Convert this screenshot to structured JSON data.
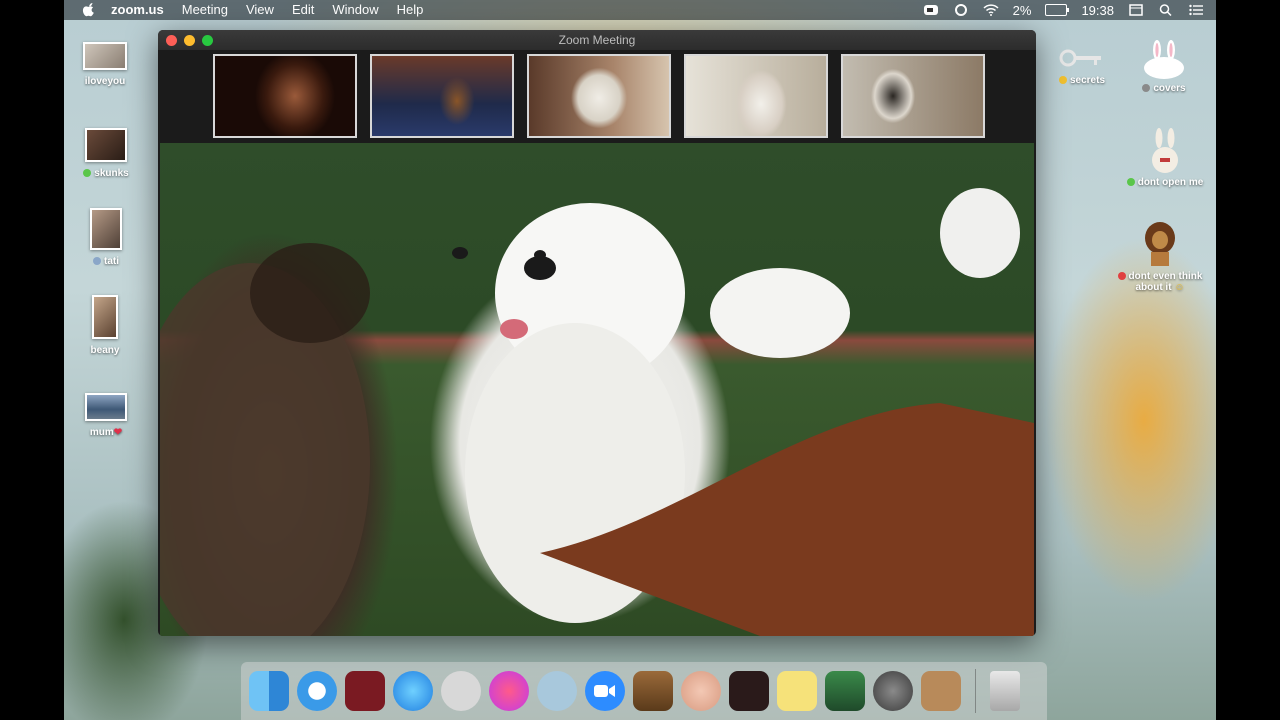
{
  "menubar": {
    "app_name": "zoom.us",
    "menus": [
      "Meeting",
      "View",
      "Edit",
      "Window",
      "Help"
    ],
    "battery_percent": "2%",
    "time": "19:38"
  },
  "desktop": {
    "left_items": [
      {
        "label": "iloveyou"
      },
      {
        "label": "skunks"
      },
      {
        "label": "tati"
      },
      {
        "label": "beany"
      },
      {
        "label": "mum"
      }
    ],
    "right_items": [
      {
        "label": "secrets"
      },
      {
        "label": "covers"
      },
      {
        "label": "dont open me"
      },
      {
        "label": "dont even think about it"
      }
    ]
  },
  "zoom": {
    "window_title": "Zoom Meeting",
    "participant_count": 5
  },
  "dock": {
    "apps": [
      "Finder",
      "Safari",
      "Photo Booth",
      "Messages",
      "Wallpaper",
      "iTunes",
      "Sequel",
      "Zoom",
      "GarageBand",
      "Face",
      "Photo Editor",
      "Stickies",
      "Preview",
      "System Preferences",
      "Contacts",
      "Trash"
    ]
  },
  "colors": {
    "close": "#fe5f57",
    "minimize": "#febc2e",
    "zoom": "#28c840",
    "dock_zoom": "#2d8cff"
  }
}
